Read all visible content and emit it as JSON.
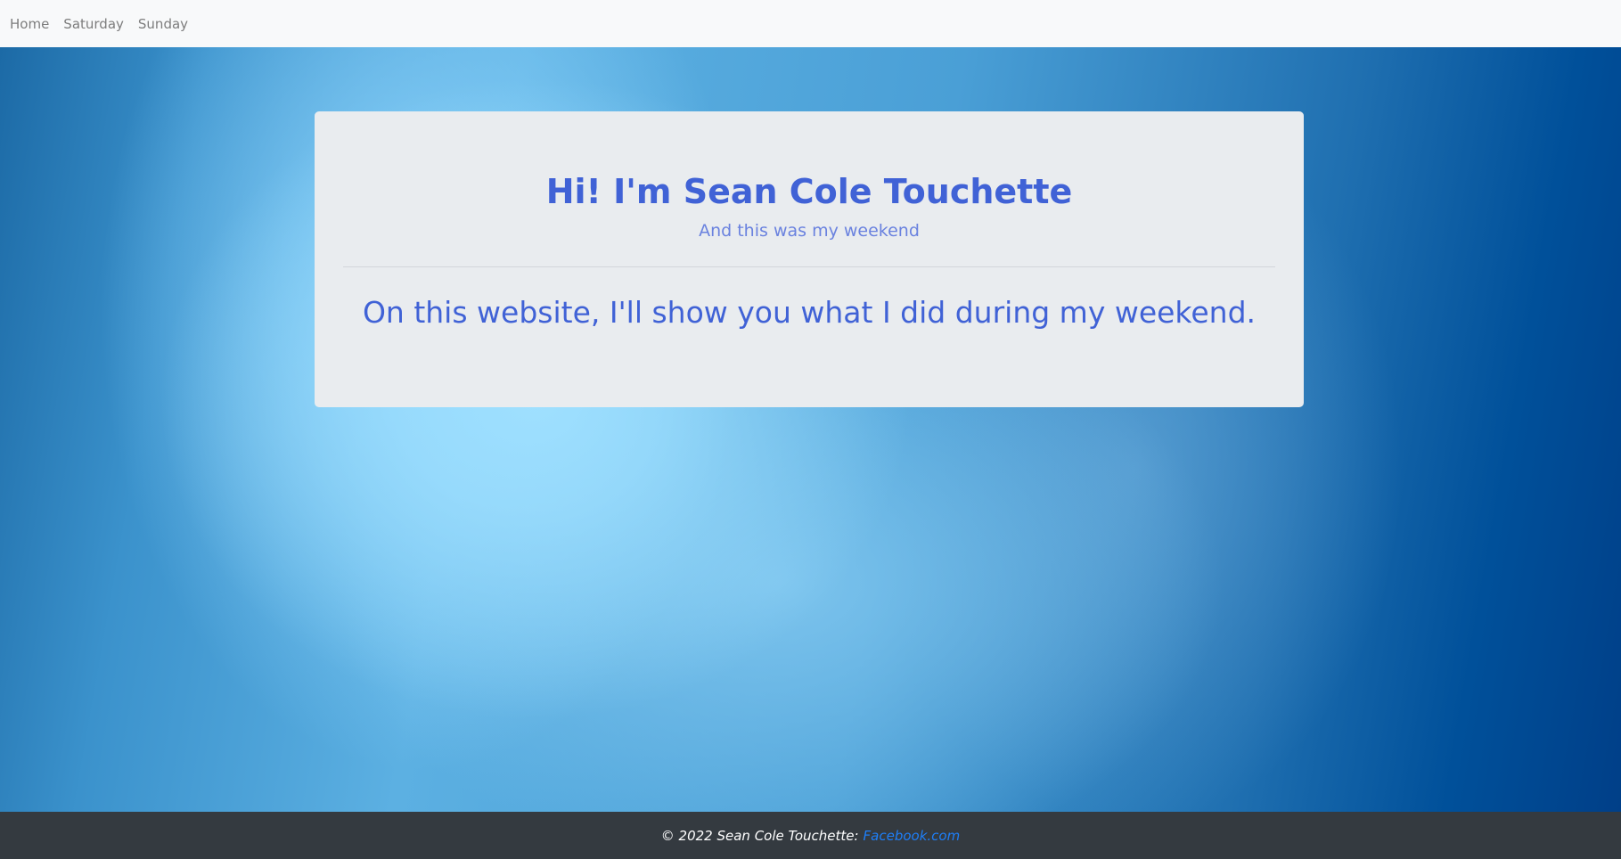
{
  "nav": {
    "items": [
      {
        "label": "Home"
      },
      {
        "label": "Saturday"
      },
      {
        "label": "Sunday"
      }
    ]
  },
  "hero": {
    "title": "Hi! I'm Sean Cole Touchette",
    "subtitle": "And this was my weekend",
    "lead": "On this website, I'll show you what I did during my weekend."
  },
  "footer": {
    "text": "© 2022 Sean Cole Touchette:",
    "link_label": "Facebook.com"
  },
  "colors": {
    "navbar_bg": "#f8f9fa",
    "nav_link": "#7d7d7d",
    "heading_blue": "#4062d6",
    "jumbotron_bg": "#e9ecef",
    "footer_bg": "#343a40",
    "footer_link": "#1e7ef7"
  }
}
